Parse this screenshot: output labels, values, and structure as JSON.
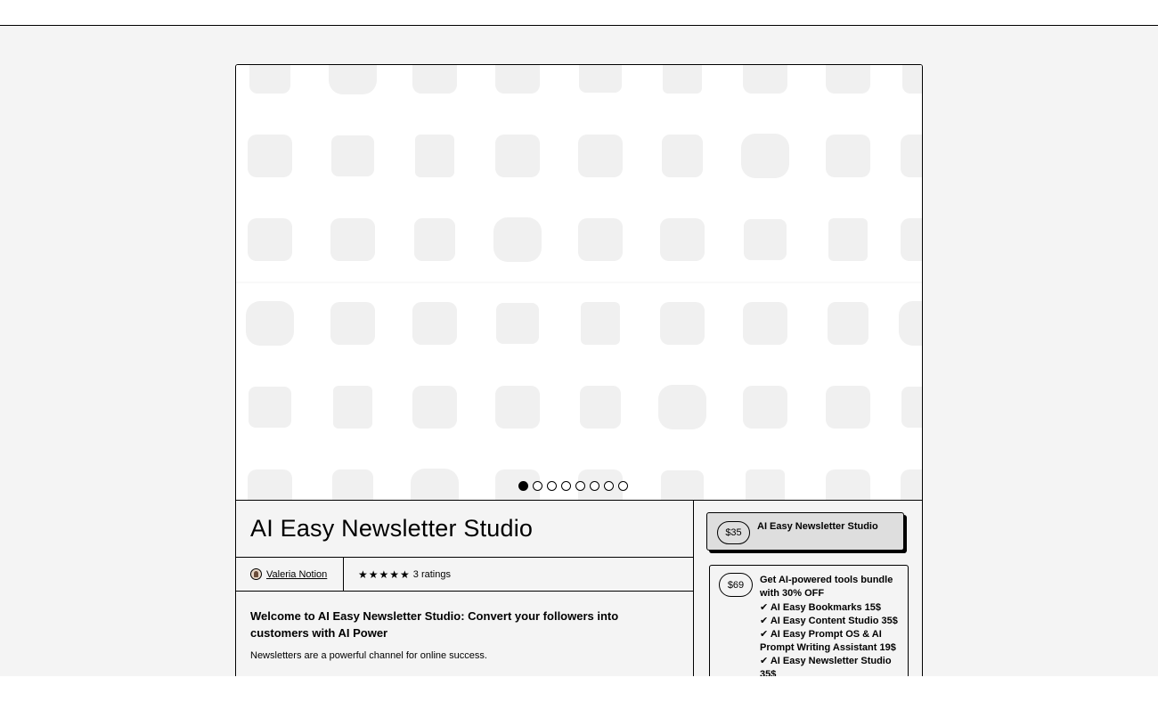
{
  "product": {
    "title": "AI Easy Newsletter Studio",
    "creator": "Valeria Notion",
    "stars": "★★★★★",
    "ratings_count": "3 ratings",
    "description_heading": "Welcome to AI Easy Newsletter Studio: Convert your followers into customers with AI Power",
    "description_text": "Newsletters are a powerful channel for online success."
  },
  "carousel": {
    "slide_count": 8,
    "active_index": 0
  },
  "options": [
    {
      "price": "$35",
      "name": "AI Easy Newsletter Studio",
      "selected": true
    },
    {
      "price": "$69",
      "name": "Get AI-powered tools bundle with 30% OFF",
      "items": [
        "✔ AI Easy Bookmarks 15$",
        "✔ AI Easy Content Studio 35$",
        "✔ AI Easy Prompt OS & AI Prompt Writing Assistant 19$",
        "✔ AI Easy Newsletter Studio 35$"
      ]
    }
  ],
  "colors": {
    "page_background": "#f4f4f4",
    "pattern_icons": "#f0f0f0",
    "selected_option": "#dedede"
  }
}
